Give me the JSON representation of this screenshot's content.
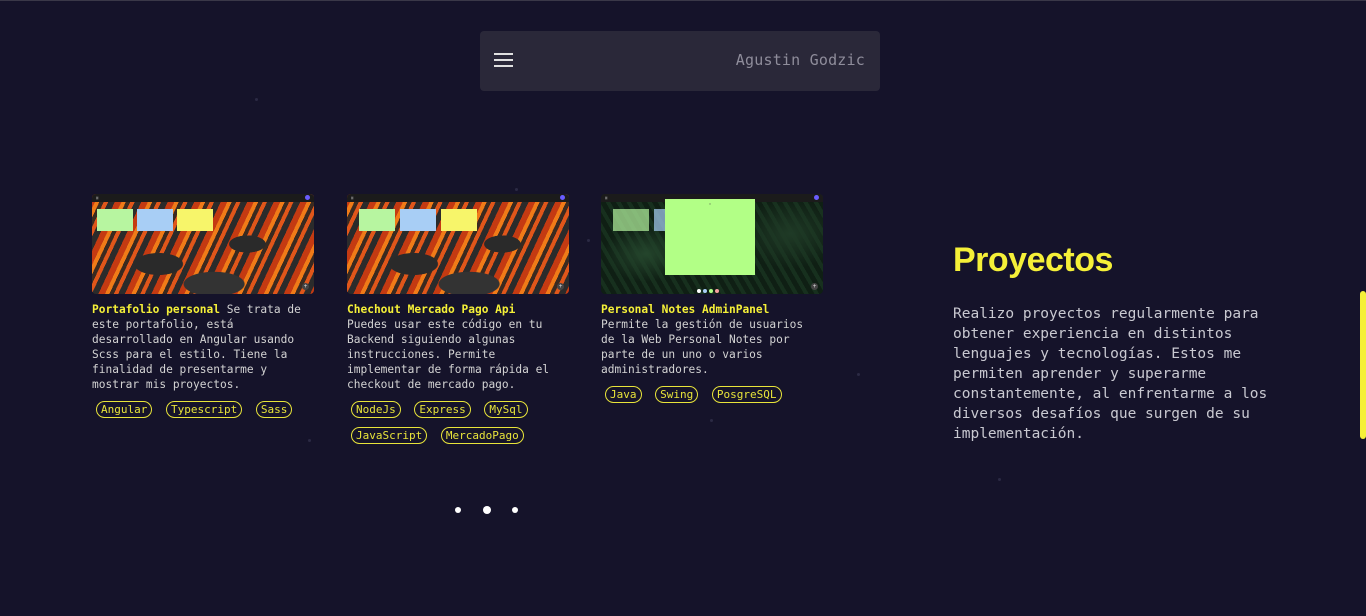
{
  "colors": {
    "background": "#15132a",
    "accent": "#f5f038",
    "navbar": "#2a2839"
  },
  "navbar": {
    "menu_icon": "hamburger-menu-icon",
    "name": "Agustin Godzic"
  },
  "projects": [
    {
      "title": "Portafolio personal",
      "description": " Se trata de este portafolio, está desarrollado en Angular usando Scss para el estilo. Tiene la finalidad de presentarme y mostrar mis proyectos.",
      "tags": [
        "Angular",
        "Typescript",
        "Sass"
      ]
    },
    {
      "title": "Chechout Mercado Pago Api",
      "description": "Puedes usar este código en tu Backend siguiendo algunas instrucciones. Permite implementar de forma rápida el checkout de mercado pago.",
      "tags": [
        "NodeJs",
        "Express",
        "MySql",
        "JavaScript",
        "MercadoPago"
      ]
    },
    {
      "title": "Personal Notes AdminPanel",
      "description": "Permite la gestión de usuarios de la Web Personal Notes por parte de un uno o varios administradores.",
      "tags": [
        "Java",
        "Swing",
        "PosgreSQL"
      ]
    }
  ],
  "pager": {
    "pages": 3,
    "active": 2
  },
  "section": {
    "title": "Proyectos",
    "description": "Realizo proyectos regularmente para obtener experiencia en distintos lenguajes y tecnologías. Estos me permiten aprender y superarme constantemente, al enfrentarme a los diversos desafíos que surgen de su implementación."
  }
}
